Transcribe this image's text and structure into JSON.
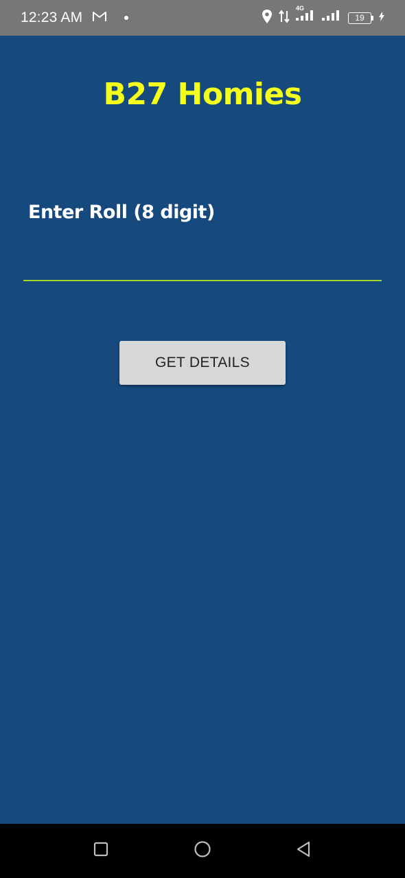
{
  "status_bar": {
    "time": "12:23 AM",
    "battery_level": "19",
    "network_type": "4G",
    "icons": [
      "gmail-icon",
      "notification-dot-icon",
      "location-icon",
      "data-transfer-icon",
      "signal-4g-icon",
      "signal-icon",
      "battery-icon",
      "charging-icon"
    ]
  },
  "app": {
    "title": "B27 Homies",
    "roll_label": "Enter Roll (8 digit)",
    "roll_input_value": "",
    "roll_input_placeholder": "",
    "button_label": "GET DETAILS"
  },
  "colors": {
    "background": "#16497d",
    "title": "#f4ff1b",
    "input_underline": "#a2d62c",
    "button": "#d6d7d7",
    "status_bar": "#777777"
  },
  "nav_bar": {
    "icons": [
      "recent-apps-icon",
      "home-icon",
      "back-icon"
    ]
  }
}
